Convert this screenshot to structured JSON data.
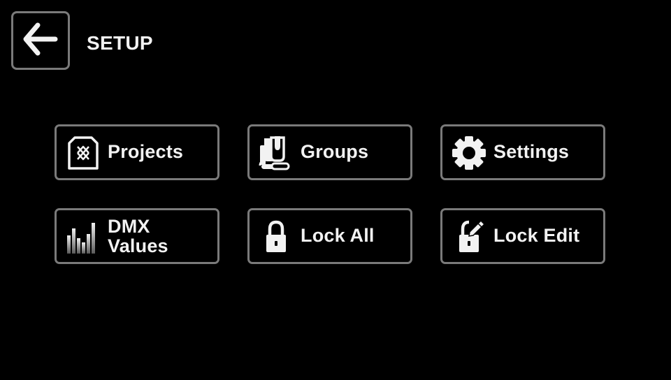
{
  "header": {
    "title": "SETUP",
    "back_icon": "arrow-left-icon"
  },
  "menu": {
    "projects": {
      "label": "Projects",
      "icon": "document-diamond-icon"
    },
    "groups": {
      "label": "Groups",
      "icon": "stacked-fixtures-icon"
    },
    "settings": {
      "label": "Settings",
      "icon": "gear-icon"
    },
    "dmx_values": {
      "label_line1": "DMX",
      "label_line2": "Values",
      "icon": "level-bars-icon"
    },
    "lock_all": {
      "label": "Lock All",
      "icon": "padlock-icon"
    },
    "lock_edit": {
      "label": "Lock Edit",
      "icon": "padlock-pencil-icon"
    }
  },
  "colors": {
    "background": "#000000",
    "border": "#7a7a7a",
    "text": "#f2f2f2"
  }
}
